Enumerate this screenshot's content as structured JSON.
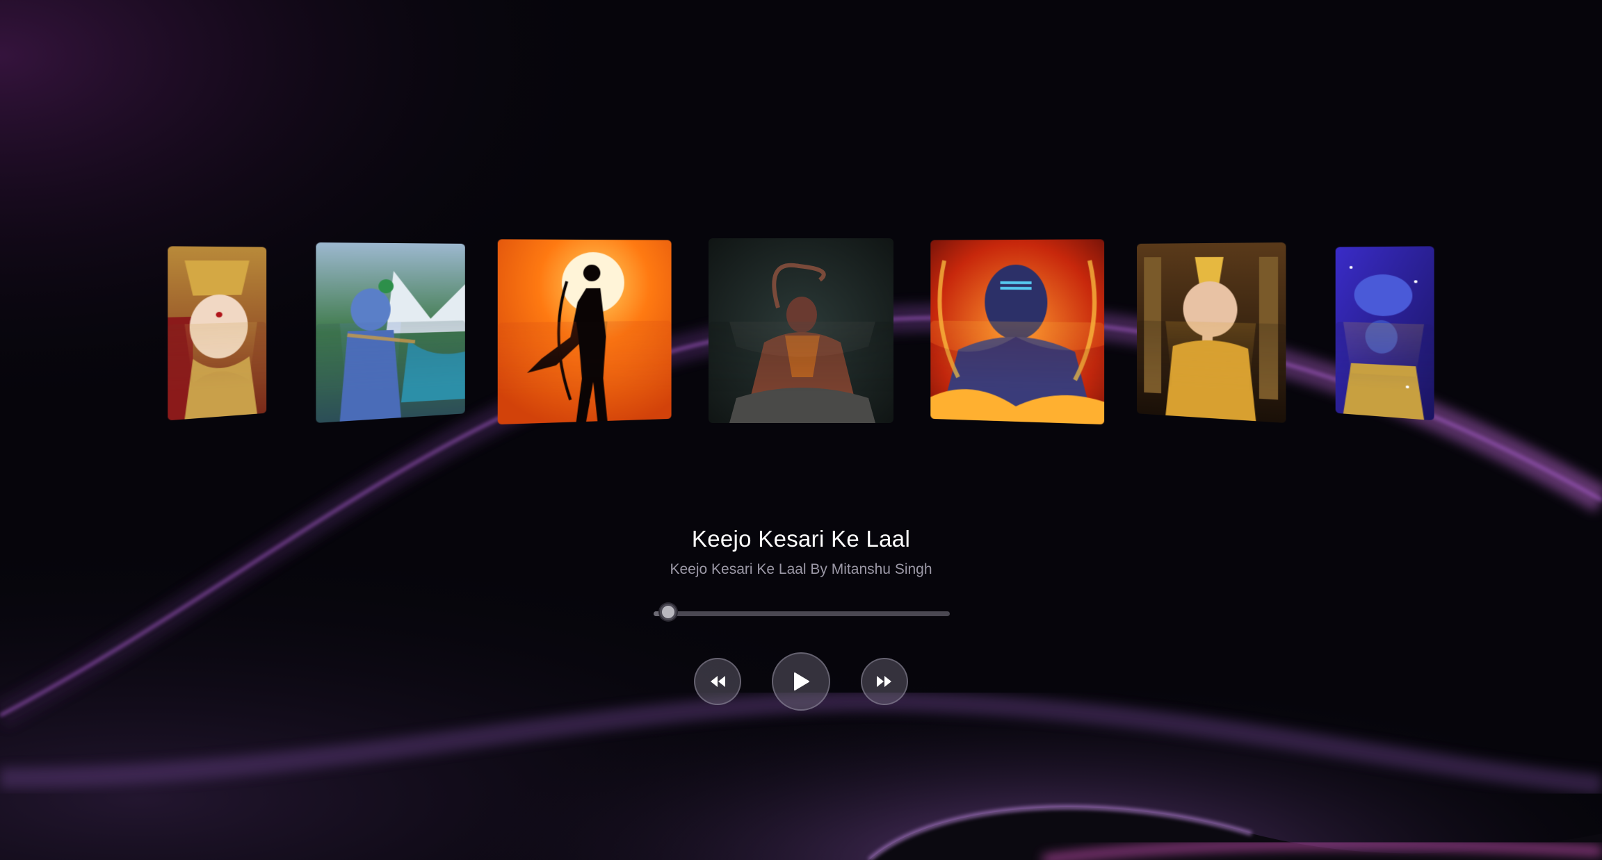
{
  "now_playing": {
    "title": "Keejo Kesari Ke Laal",
    "subtitle": "Keejo Kesari Ke Laal By Mitanshu Singh",
    "progress": 0.05
  },
  "covers": [
    {
      "subject": "goddess-durga-artwork"
    },
    {
      "subject": "krishna-flute-artwork"
    },
    {
      "subject": "ram-silhouette-sunset-artwork"
    },
    {
      "subject": "hanuman-meditating-artwork"
    },
    {
      "subject": "shiva-fire-artwork"
    },
    {
      "subject": "ganesha-golden-artwork"
    },
    {
      "subject": "krishna-blue-cosmic-artwork"
    }
  ],
  "controls": {
    "previous_icon": "rewind-icon",
    "play_icon": "play-icon",
    "next_icon": "fast-forward-icon"
  },
  "colors": {
    "background": "#06050b",
    "accent_glow": "#8a3fb8",
    "title": "#ffffff",
    "subtitle": "#9b98a6"
  }
}
